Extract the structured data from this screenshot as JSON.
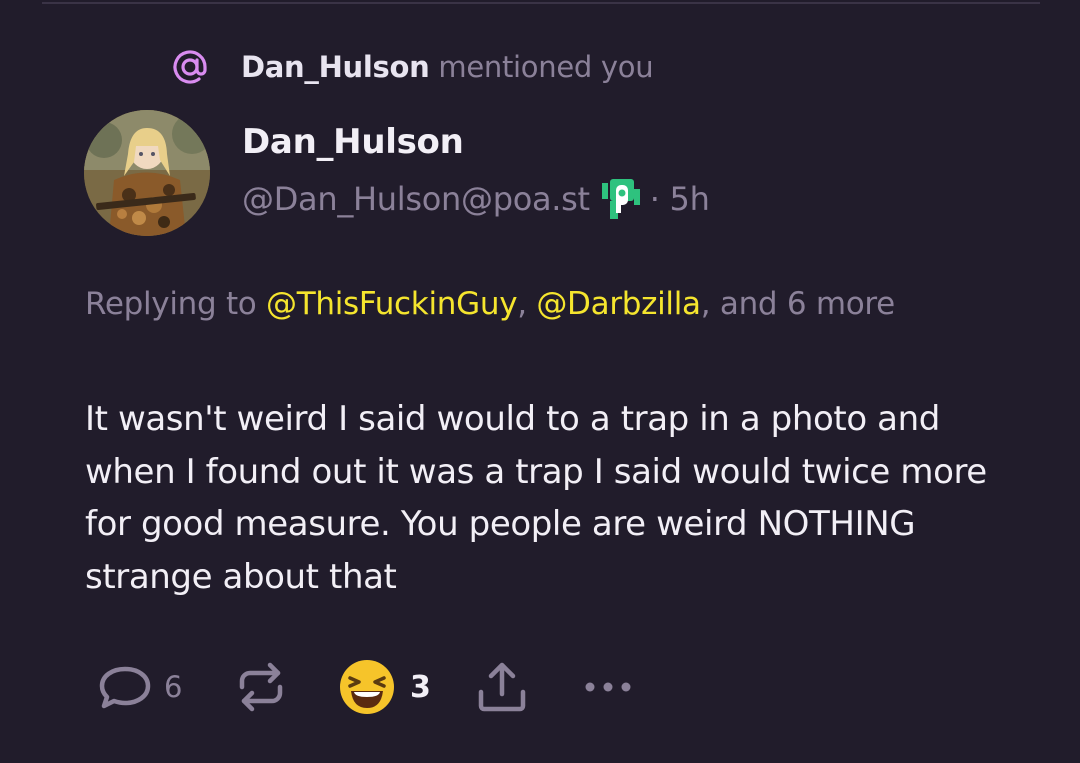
{
  "notification": {
    "icon": "at-sign-icon",
    "username": "Dan_Hulson",
    "text": "mentioned you"
  },
  "author": {
    "display_name": "Dan_Hulson",
    "handle": "@Dan_Hulson@poa.st",
    "instance_icon": "pleroma-icon",
    "age": "· 5h"
  },
  "reply": {
    "prefix": "Replying to",
    "mention_1": "@ThisFuckinGuy",
    "separator": ",",
    "mention_2": "@Darbzilla",
    "suffix": ", and 6 more"
  },
  "body": "It wasn't weird I said would to a trap in a photo and when I found out it was a trap I said would twice more for good measure. You people are weird NOTHING strange about that",
  "actions": {
    "reply_icon": "speech-bubble-icon",
    "reply_count": "6",
    "repost_icon": "repost-icon",
    "reaction_icon": "laughing-face-emoji",
    "reaction_count": "3",
    "share_icon": "share-upload-icon",
    "more_icon": "more-dots-icon"
  },
  "colors": {
    "background": "#211c2b",
    "muted": "#8b8199",
    "mention_link": "#f5e52e",
    "accent": "#d98cf0",
    "instance_green": "#2ec27e"
  }
}
